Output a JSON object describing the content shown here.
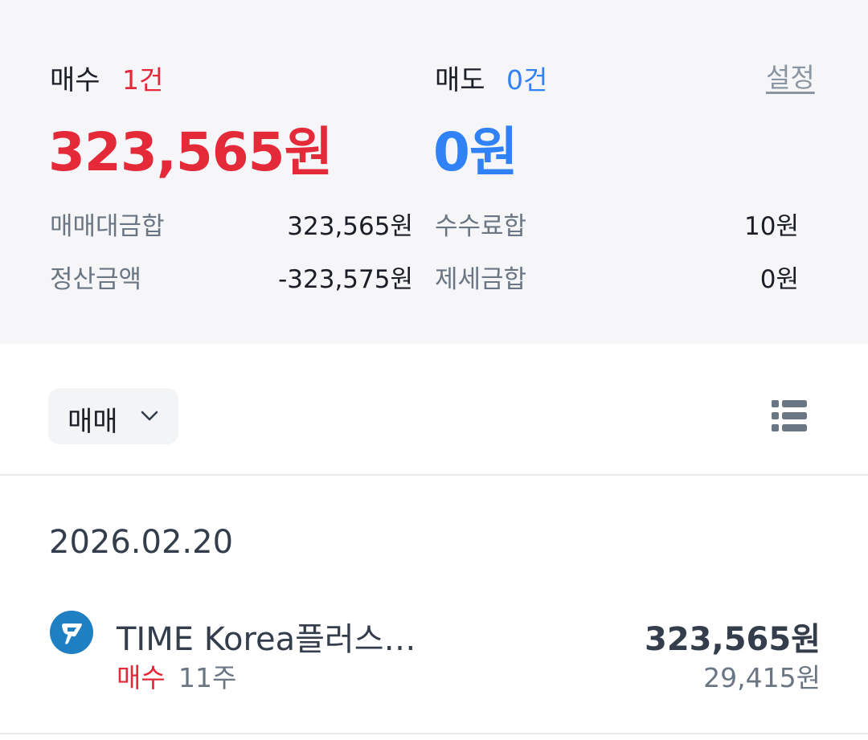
{
  "summary": {
    "buy_label": "매수",
    "buy_count": "1건",
    "buy_amount": "323,565원",
    "sell_label": "매도",
    "sell_count": "0건",
    "sell_amount": "0원",
    "settings_label": "설정",
    "rows": [
      {
        "label": "매매대금합",
        "value": "323,565원"
      },
      {
        "label": "정산금액",
        "value": "-323,575원"
      },
      {
        "label": "수수료합",
        "value": "10원"
      },
      {
        "label": "제세금합",
        "value": "0원"
      }
    ]
  },
  "filter": {
    "selected": "매매",
    "icon": "chevron-down-icon"
  },
  "view_toggle_icon": "list-view-icon",
  "trades": {
    "date": "2026.02.20",
    "items": [
      {
        "name": "TIME Korea플러스…",
        "side": "매수",
        "quantity": "11주",
        "amount": "323,565원",
        "unit_price": "29,415원"
      }
    ]
  },
  "colors": {
    "buy": "#e42939",
    "sell": "#3182f6",
    "summary_bg": "#f6f6f8",
    "logo": "#1e7fc2"
  }
}
